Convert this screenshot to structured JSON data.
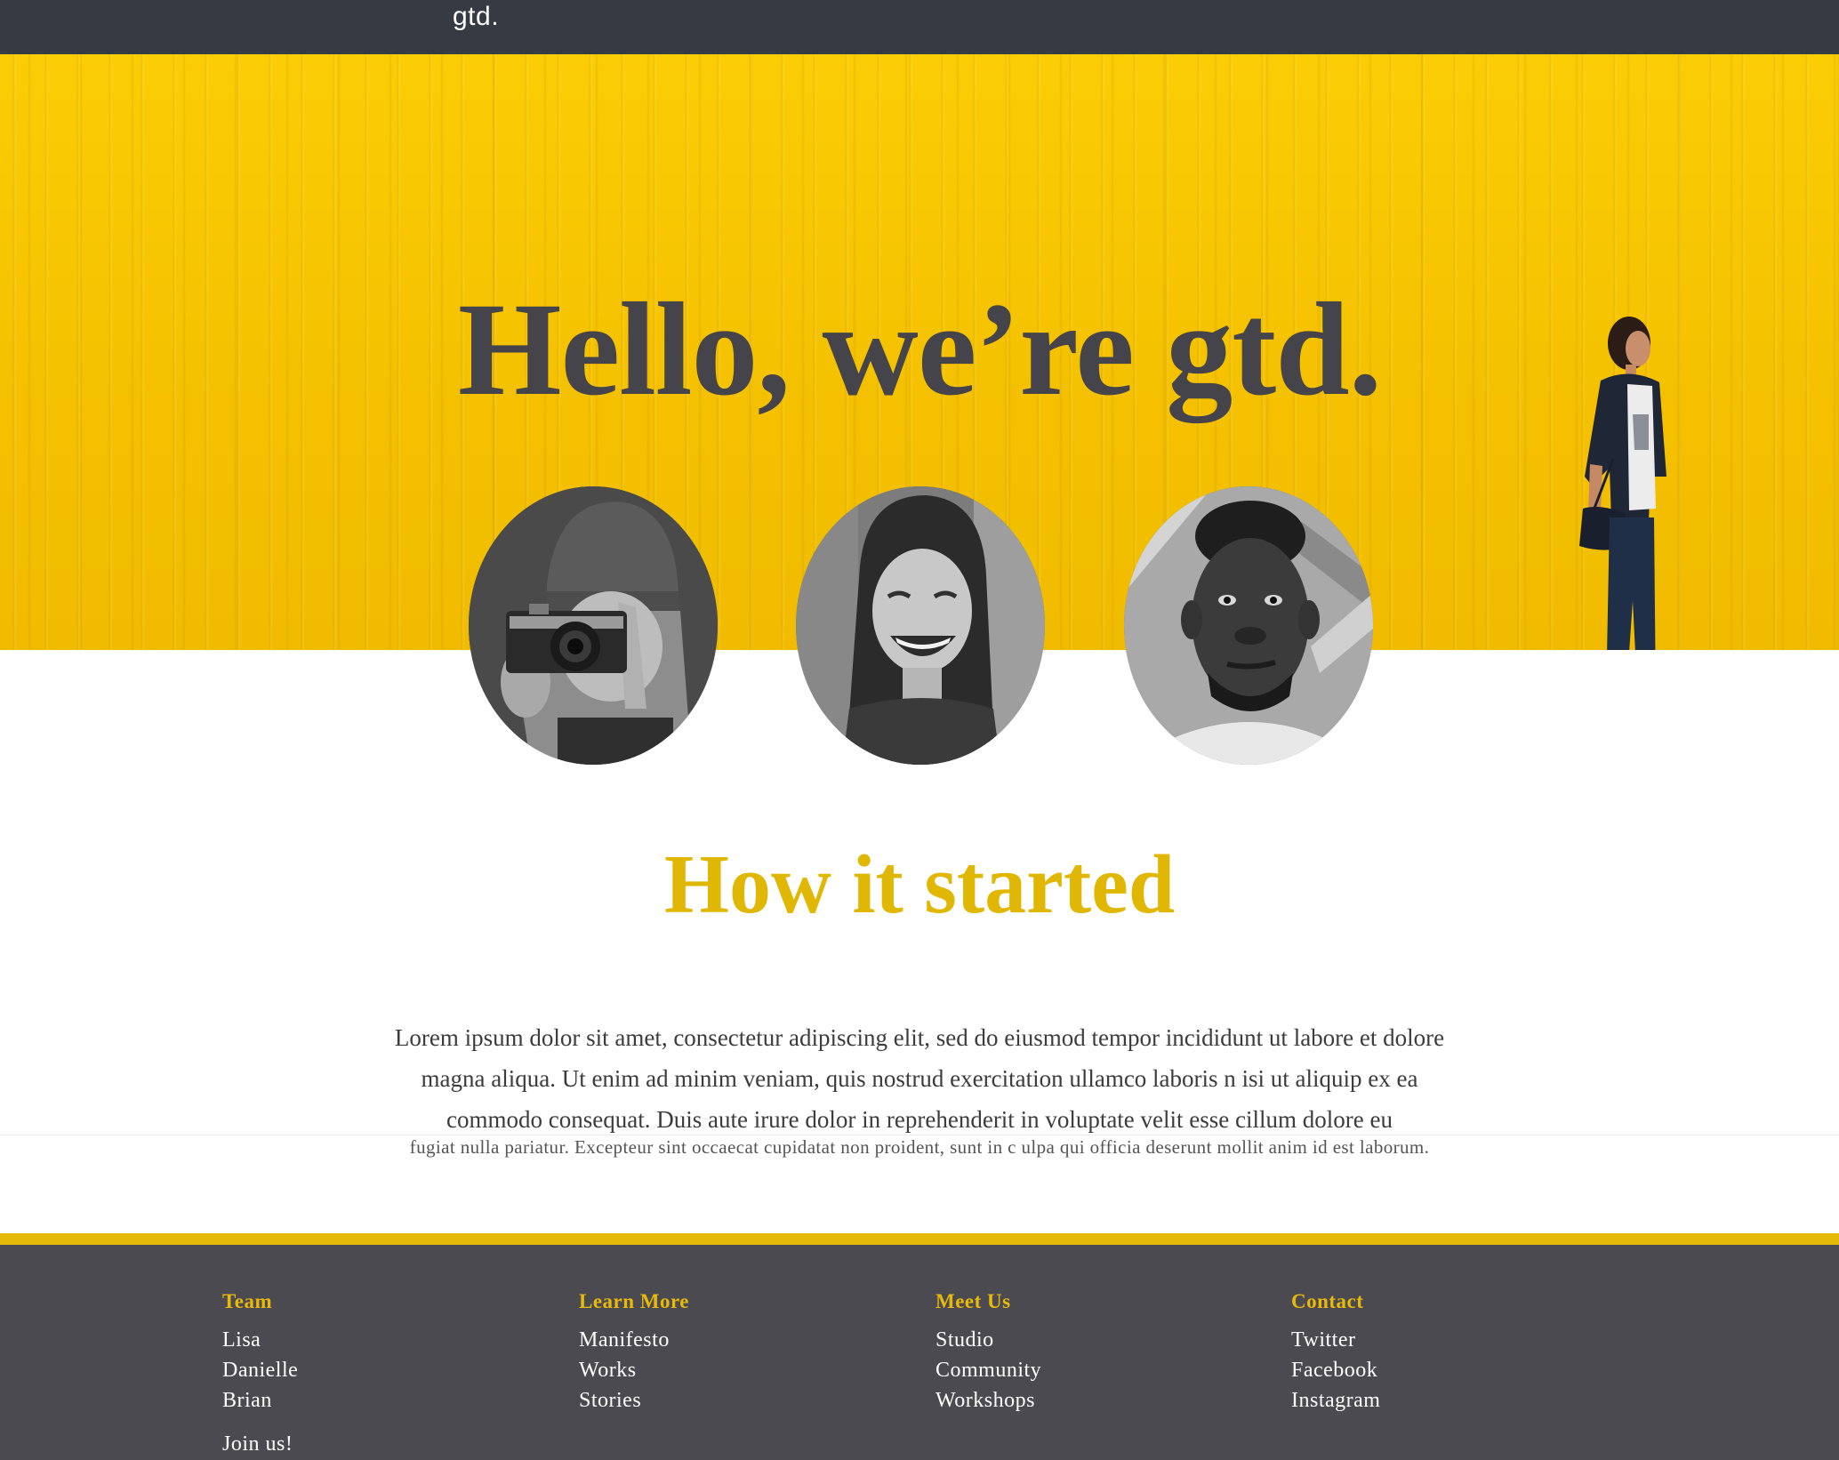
{
  "header": {
    "brand": "gtd."
  },
  "hero": {
    "title": "Hello, we’re gtd."
  },
  "team": [
    {
      "name": "photographer-avatar"
    },
    {
      "name": "laughing-woman-avatar"
    },
    {
      "name": "man-portrait-avatar"
    }
  ],
  "about": {
    "title": "How it started",
    "paragraph": "Lorem ipsum dolor sit amet, consectetur adipiscing elit, sed do eiusmod tempor incididunt ut labore et dolore magna aliqua. Ut enim ad minim veniam, quis nostrud exercitation ullamco laboris n isi ut aliquip ex ea commodo consequat. Duis aute irure dolor in reprehenderit in voluptate velit esse cillum dolore eu",
    "paragraph_continued": "fugiat nulla pariatur. Excepteur sint occaecat cupidatat non proident, sunt in c ulpa qui officia deserunt mollit anim id est laborum."
  },
  "footer": {
    "columns": [
      {
        "heading": "Team",
        "links": [
          "Lisa",
          "Danielle",
          "Brian"
        ]
      },
      {
        "heading": "Learn More",
        "links": [
          "Manifesto",
          "Works",
          "Stories"
        ]
      },
      {
        "heading": "Meet Us",
        "links": [
          "Studio",
          "Community",
          "Workshops"
        ]
      },
      {
        "heading": "Contact",
        "links": [
          "Twitter",
          "Facebook",
          "Instagram"
        ]
      }
    ],
    "cta": "Join us!"
  },
  "colors": {
    "nav_bg": "#363a43",
    "hero_yellow": "#f7c600",
    "accent": "#e0b705",
    "footer_bg": "#4a4a50",
    "title_dark": "#45444a"
  }
}
